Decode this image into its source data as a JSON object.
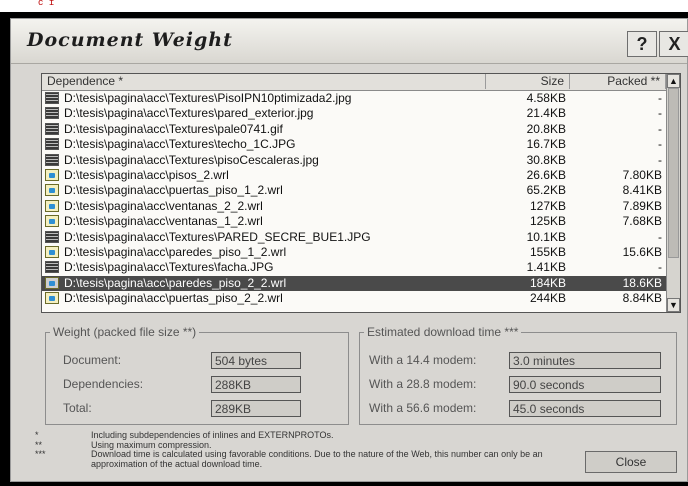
{
  "window": {
    "title": "Document Weight",
    "help_label": "?",
    "close_glyph": "X"
  },
  "list": {
    "columns": {
      "dependence": "Dependence *",
      "size": "Size",
      "packed": "Packed **"
    },
    "rows": [
      {
        "path": "D:\\tesis\\pagina\\acc\\Textures\\PisoIPN10ptimizada2.jpg",
        "size": "4.58KB",
        "packed": "-",
        "icon": "image-file-icon"
      },
      {
        "path": "D:\\tesis\\pagina\\acc\\Textures\\pared_exterior.jpg",
        "size": "21.4KB",
        "packed": "-",
        "icon": "image-file-icon"
      },
      {
        "path": "D:\\tesis\\pagina\\acc\\Textures\\pale0741.gif",
        "size": "20.8KB",
        "packed": "-",
        "icon": "image-file-icon"
      },
      {
        "path": "D:\\tesis\\pagina\\acc\\Textures\\techo_1C.JPG",
        "size": "16.7KB",
        "packed": "-",
        "icon": "image-file-icon"
      },
      {
        "path": "D:\\tesis\\pagina\\acc\\Textures\\pisoCescaleras.jpg",
        "size": "30.8KB",
        "packed": "-",
        "icon": "image-file-icon"
      },
      {
        "path": "D:\\tesis\\pagina\\acc\\pisos_2.wrl",
        "size": "26.6KB",
        "packed": "7.80KB",
        "icon": "wrl-file-icon"
      },
      {
        "path": "D:\\tesis\\pagina\\acc\\puertas_piso_1_2.wrl",
        "size": "65.2KB",
        "packed": "8.41KB",
        "icon": "wrl-file-icon"
      },
      {
        "path": "D:\\tesis\\pagina\\acc\\ventanas_2_2.wrl",
        "size": "127KB",
        "packed": "7.89KB",
        "icon": "wrl-file-icon"
      },
      {
        "path": "D:\\tesis\\pagina\\acc\\ventanas_1_2.wrl",
        "size": "125KB",
        "packed": "7.68KB",
        "icon": "wrl-file-icon"
      },
      {
        "path": "D:\\tesis\\pagina\\acc\\Textures\\PARED_SECRE_BUE1.JPG",
        "size": "10.1KB",
        "packed": "-",
        "icon": "image-file-icon"
      },
      {
        "path": "D:\\tesis\\pagina\\acc\\paredes_piso_1_2.wrl",
        "size": "155KB",
        "packed": "15.6KB",
        "icon": "wrl-file-icon"
      },
      {
        "path": "D:\\tesis\\pagina\\acc\\Textures\\facha.JPG",
        "size": "1.41KB",
        "packed": "-",
        "icon": "image-file-icon"
      },
      {
        "path": "D:\\tesis\\pagina\\acc\\paredes_piso_2_2.wrl",
        "size": "184KB",
        "packed": "18.6KB",
        "icon": "wrl-file-icon",
        "selected": true
      },
      {
        "path": "D:\\tesis\\pagina\\acc\\puertas_piso_2_2.wrl",
        "size": "244KB",
        "packed": "8.84KB",
        "icon": "wrl-file-icon"
      }
    ]
  },
  "weight": {
    "legend": "Weight (packed file size **)",
    "document_label": "Document:",
    "document_value": "504 bytes",
    "dependencies_label": "Dependencies:",
    "dependencies_value": "288KB",
    "total_label": "Total:",
    "total_value": "289KB"
  },
  "download": {
    "legend": "Estimated download time ***",
    "m144_label": "With a 14.4 modem:",
    "m144_value": "3.0 minutes",
    "m288_label": "With a 28.8 modem:",
    "m288_value": "90.0 seconds",
    "m566_label": "With a 56.6 modem:",
    "m566_value": "45.0 seconds"
  },
  "notes": [
    {
      "mark": "*",
      "text": "Including subdependencies of inlines and EXTERNPROTOs."
    },
    {
      "mark": "**",
      "text": "Using maximum compression."
    },
    {
      "mark": "***",
      "text": "Download time is calculated using favorable conditions. Due to the nature of the Web, this number can only be an approximation of the actual download time."
    }
  ],
  "close_button": "Close",
  "colors": {
    "selected_row": "#4a4a4a",
    "window_bg": "#d8d6d2",
    "list_bg": "#fbfaf7"
  }
}
